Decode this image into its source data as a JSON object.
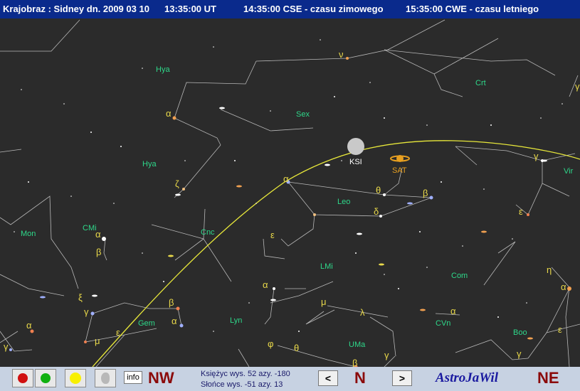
{
  "title": {
    "location": "Krajobraz : Sidney dn. 2009 03 10",
    "ut": "13:35:00 UT",
    "cse": "14:35:00 CSE - czasu zimowego",
    "cwe": "15:35:00 CWE - czasu letniego"
  },
  "constellations": {
    "hya1": "Hya",
    "hya2": "Hya",
    "sex": "Sex",
    "crt": "Crt",
    "vir": "Vir",
    "leo": "Leo",
    "cnc": "Cnc",
    "mon": "Mon",
    "cmi": "CMi",
    "lmi": "LMi",
    "com": "Com",
    "gem": "Gem",
    "lyn": "Lyn",
    "cvn": "CVn",
    "boo": "Boo",
    "uma": "UMa"
  },
  "objects": {
    "moon": "KSI",
    "saturn": "SAT"
  },
  "greek": {
    "nu": "ν",
    "alpha_hya": "α",
    "zeta": "ζ",
    "alpha_leo": "α",
    "theta_leo": "θ",
    "beta_leo": "β",
    "delta_leo": "δ",
    "epsilon_leo": "ε",
    "gamma_vir": "γ",
    "epsilon_vir": "ε",
    "gamma_right": "γ",
    "alpha_cmi": "α",
    "beta_cmi": "β",
    "xi": "ξ",
    "gamma_gem": "γ",
    "beta_gem": "β",
    "alpha_gem": "α",
    "epsilon_gem": "ε",
    "mu_gem": "μ",
    "alpha_mon": "α",
    "gamma_far": "γ",
    "alpha_lyn": "α",
    "mu_uma": "μ",
    "lambda_uma": "λ",
    "phi": "φ",
    "theta_uma": "θ",
    "beta_uma": "β",
    "gamma_uma": "γ",
    "alpha_cvn": "α",
    "eta": "η",
    "alpha_boo": "α",
    "epsilon_boo": "ε",
    "gamma_boo": "γ"
  },
  "toolbar": {
    "info_label": "info",
    "dir_left": "NW",
    "dir_center": "N",
    "dir_right": "NE",
    "prev_label": "<",
    "next_label": ">",
    "moon_info": "Księżyc wys. 52   azy. -180",
    "sun_info": "Słońce wys. -51   azy. 13",
    "brand": "AstroJaWil"
  },
  "colors": {
    "title_bg": "#0a2a8c",
    "sky_bg": "#2b2b2b",
    "ecliptic": "#e8e83a",
    "constellation_label": "#2ed88a",
    "greek_label": "#e8d84a",
    "toolbar_bg": "#c7d2e2",
    "button_red": "#d01010",
    "button_green": "#10b010",
    "button_yellow": "#f8f000",
    "direction": "#8b0a0a"
  }
}
